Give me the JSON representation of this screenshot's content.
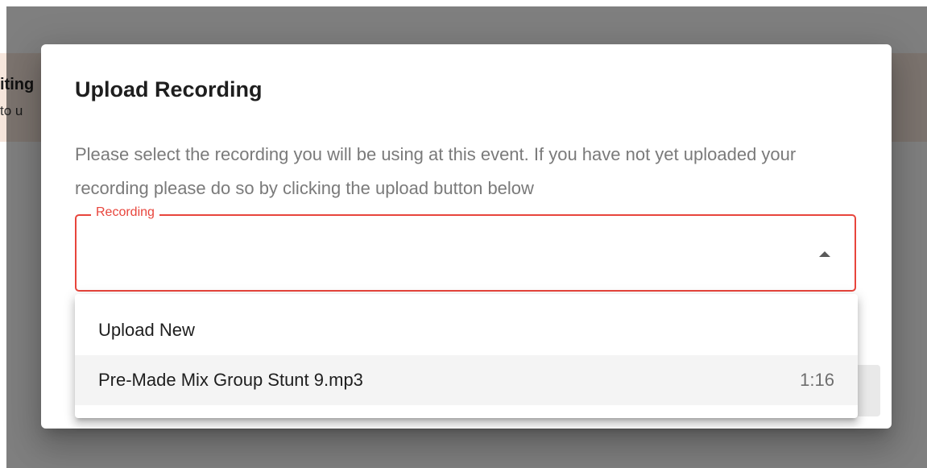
{
  "background": {
    "banner_title": "iting",
    "banner_subtitle": "to u"
  },
  "modal": {
    "title": "Upload Recording",
    "description": "Please select the recording you will be using at this event. If you have not yet uploaded your recording please do so by clicking the upload button below",
    "select": {
      "label": "Recording",
      "value": "",
      "accent_color": "#e8453c",
      "state": "open"
    },
    "menu": {
      "items": [
        {
          "label": "Upload New",
          "duration": ""
        },
        {
          "label": "Pre-Made Mix Group Stunt 9.mp3",
          "duration": "1:16"
        }
      ]
    }
  },
  "icons": {
    "select_caret": "caret-up-icon"
  }
}
